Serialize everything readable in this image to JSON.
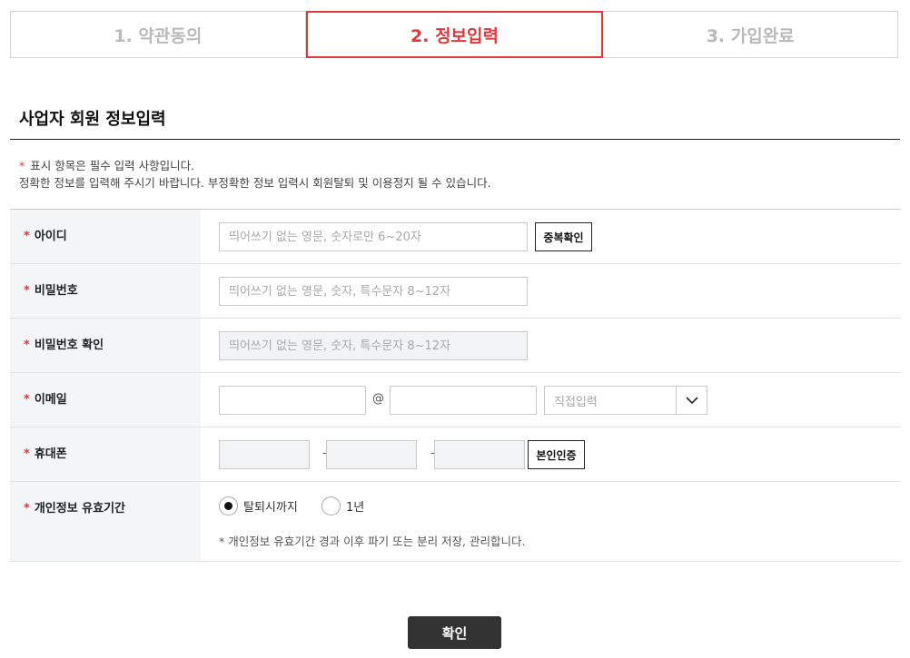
{
  "steps": [
    "1. 약관동의",
    "2. 정보입력",
    "3. 가입완료"
  ],
  "section_title": "사업자 회원 정보입력",
  "notice": {
    "star": "*",
    "line1": "표시 항목은 필수 입력 사항입니다.",
    "line2": "정확한 정보를 입력해 주시기 바랍니다. 부정확한 정보 입력시 회원탈퇴 및 이용정지 될 수 있습니다."
  },
  "required_mark": "*",
  "fields": {
    "id": {
      "label": "아이디",
      "placeholder": "띄어쓰기 없는 영문, 숫자로만 6~20자",
      "button": "중복확인"
    },
    "password": {
      "label": "비밀번호",
      "placeholder": "띄어쓰기 없는 영문, 숫자, 특수문자 8~12자"
    },
    "password_confirm": {
      "label": "비밀번호 확인",
      "placeholder": "띄어쓰기 없는 영문, 숫자, 특수문자 8~12자"
    },
    "email": {
      "label": "이메일",
      "at": "@",
      "domain_select": "직접입력"
    },
    "phone": {
      "label": "휴대폰",
      "dash": "-",
      "button": "본인인증"
    },
    "privacy_period": {
      "label": "개인정보 유효기간",
      "options": [
        "탈퇴시까지",
        "1년"
      ],
      "selected": "탈퇴시까지",
      "note": "* 개인정보 유효기간 경과 이후 파기 또는 분리 저장, 관리합니다."
    }
  },
  "confirm_button": "확인",
  "colors": {
    "accent": "#e3373e",
    "header_bg": "#f4f5f7",
    "button_dark": "#333333"
  }
}
